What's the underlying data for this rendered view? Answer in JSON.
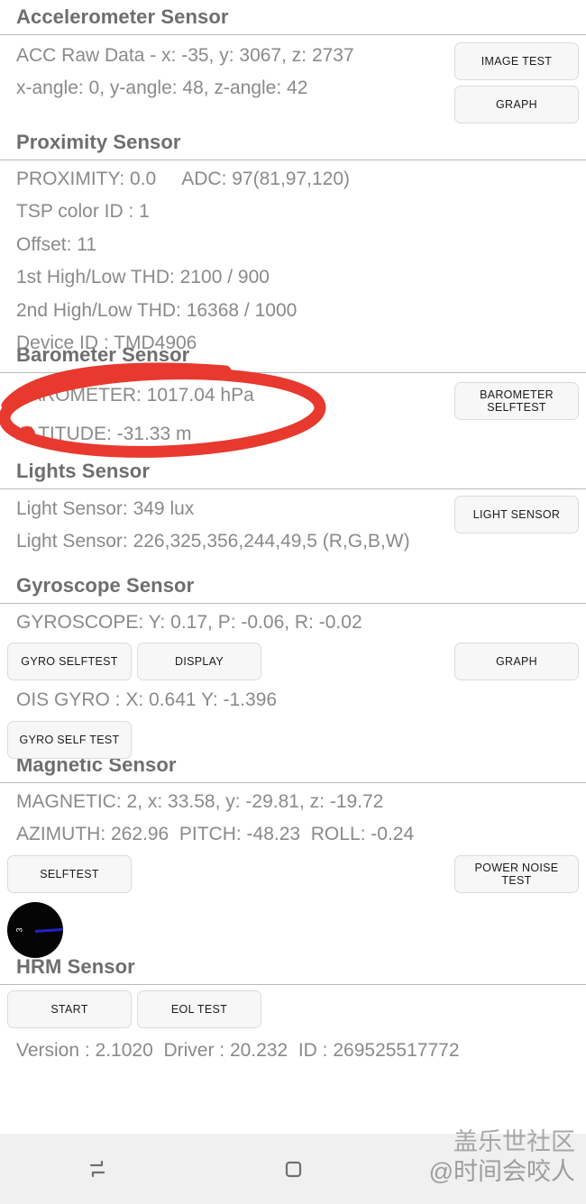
{
  "sections": [
    {
      "title": "Accelerometer Sensor",
      "lines": [
        "ACC Raw Data - x: -35, y: 3067, z: 2737",
        "x-angle: 0, y-angle: 48, z-angle: 42"
      ],
      "right_buttons": [
        "IMAGE TEST",
        "GRAPH"
      ]
    },
    {
      "title": "Proximity Sensor",
      "lines": [
        "PROXIMITY: 0.0     ADC: 97(81,97,120)",
        "TSP color ID : 1",
        "Offset: 11",
        "1st High/Low THD: 2100 / 900",
        "2nd High/Low THD: 16368 / 1000",
        "Device ID : TMD4906"
      ],
      "right_buttons": []
    },
    {
      "title": "Barometer Sensor",
      "lines": [
        "BAROMETER: 1017.04 hPa",
        "ALTITUDE: -31.33 m"
      ],
      "right_buttons": [
        "BAROMETER SELFTEST"
      ]
    },
    {
      "title": "Lights Sensor",
      "lines": [
        "Light Sensor: 349 lux",
        "Light Sensor: 226,325,356,244,49,5 (R,G,B,W)"
      ],
      "right_buttons": [
        "LIGHT SENSOR"
      ]
    },
    {
      "title": "Gyroscope Sensor",
      "lines": [
        "GYROSCOPE: Y: 0.17, P: -0.06, R: -0.02",
        "OIS GYRO : X: 0.641 Y: -1.396"
      ],
      "buttons_row1": [
        "GYRO SELFTEST",
        "DISPLAY"
      ],
      "button_row1_right": "GRAPH",
      "buttons_row2": [
        "GYRO SELF TEST"
      ]
    },
    {
      "title": "Magnetic Sensor",
      "lines": [
        "MAGNETIC: 2, x: 33.58, y: -29.81, z: -19.72",
        "AZIMUTH: 262.96  PITCH: -48.23  ROLL: -0.24"
      ],
      "button_left": "SELFTEST",
      "button_right": "POWER NOISE TEST",
      "compass_label": "3"
    },
    {
      "title": "HRM Sensor",
      "buttons": [
        "START",
        "EOL TEST"
      ],
      "version_line": "Version : 2.1020  Driver : 20.232  ID : 269525517772"
    }
  ],
  "annotation": {
    "color": "#e8392f",
    "target_text": "BAROMETER: 1017.04 hPa"
  },
  "navbar": {
    "recents_icon": "recents-icon",
    "home_icon": "home-icon"
  },
  "watermark": {
    "line1": "盖乐世社区",
    "line2": "@时间会咬人"
  }
}
